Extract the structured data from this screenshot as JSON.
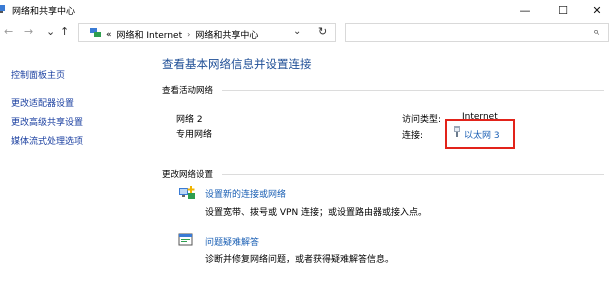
{
  "window": {
    "title": "网络和共享中心"
  },
  "title_controls": {
    "minimize": "—",
    "maximize": "☐",
    "close": "✕"
  },
  "nav": {
    "back": "←",
    "forward": "→",
    "up": "↑",
    "dropdown": "⌄",
    "refresh": "↻"
  },
  "address": {
    "overflow": "«",
    "crumbs": [
      "网络和 Internet",
      "网络和共享中心"
    ],
    "separator": "›"
  },
  "search": {
    "icon": "⌕"
  },
  "sidebar": {
    "home": "控制面板主页",
    "items": [
      "更改适配器设置",
      "更改高级共享设置",
      "媒体流式处理选项"
    ]
  },
  "main": {
    "title": "查看基本网络信息并设置连接",
    "active_section": "查看活动网络",
    "network": {
      "name": "网络 2",
      "type": "专用网络",
      "access_label": "访问类型:",
      "access_value": "Internet",
      "conn_label": "连接:",
      "conn_value": "以太网 3"
    },
    "change_section": "更改网络设置",
    "tasks": [
      {
        "link": "设置新的连接或网络",
        "desc": "设置宽带、拨号或 VPN 连接；或设置路由器或接入点。"
      },
      {
        "link": "问题疑难解答",
        "desc": "诊断并修复网络问题，或者获得疑难解答信息。"
      }
    ]
  },
  "colors": {
    "link": "#1a5fb4",
    "title": "#1e4e96",
    "highlight": "#e2231a"
  }
}
